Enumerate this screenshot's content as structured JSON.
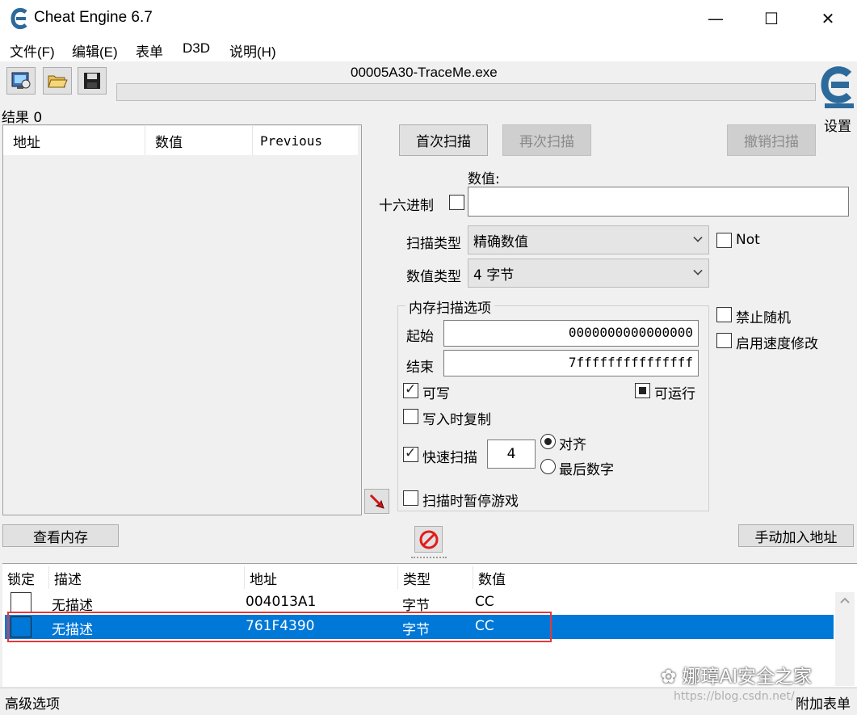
{
  "window": {
    "title": "Cheat Engine 6.7",
    "minimize": "—",
    "maximize": "☐",
    "close": "✕"
  },
  "menu": [
    "文件(F)",
    "编辑(E)",
    "表单",
    "D3D",
    "说明(H)"
  ],
  "toolbar": {
    "process_name": "00005A30-TraceMe.exe",
    "settings_label": "设置",
    "icons": [
      "open-process-icon",
      "open-file-icon",
      "save-icon"
    ]
  },
  "results": {
    "count_label": "结果 0",
    "columns": [
      "地址",
      "数值",
      "Previous"
    ]
  },
  "scan": {
    "first_scan": "首次扫描",
    "next_scan": "再次扫描",
    "undo_scan": "撤销扫描",
    "value_label": "数值:",
    "hex_label": "十六进制",
    "value": "",
    "scan_type_label": "扫描类型",
    "scan_type": "精确数值",
    "value_type_label": "数值类型",
    "value_type": "4 字节",
    "not_label": "Not",
    "no_random_label": "禁止随机",
    "speedhack_label": "启用速度修改"
  },
  "memory_options": {
    "group_label": "内存扫描选项",
    "start_label": "起始",
    "start_value": "0000000000000000",
    "end_label": "结束",
    "end_value": "7fffffffffffffff",
    "writable_label": "可写",
    "executable_label": "可运行",
    "copy_on_write_label": "写入时复制",
    "fast_scan_label": "快速扫描",
    "fast_scan_value": "4",
    "align_label": "对齐",
    "last_digits_label": "最后数字",
    "pause_label": "扫描时暂停游戏"
  },
  "buttons": {
    "view_memory": "查看内存",
    "add_address": "手动加入地址"
  },
  "address_table": {
    "columns": [
      "锁定",
      "描述",
      "地址",
      "类型",
      "数值"
    ],
    "rows": [
      {
        "description": "无描述",
        "address": "004013A1",
        "type": "字节",
        "value": "CC"
      },
      {
        "description": "无描述",
        "address": "761F4390",
        "type": "字节",
        "value": "CC"
      }
    ]
  },
  "status": {
    "advanced": "高级选项",
    "table_extras": "附加表单"
  },
  "watermark": {
    "text": "娜璋AI安全之家",
    "url": "https://blog.csdn.net/"
  },
  "colors": {
    "selection": "#0078d7",
    "highlight_border": "#e23a3a",
    "panel": "#f0f0f0"
  }
}
